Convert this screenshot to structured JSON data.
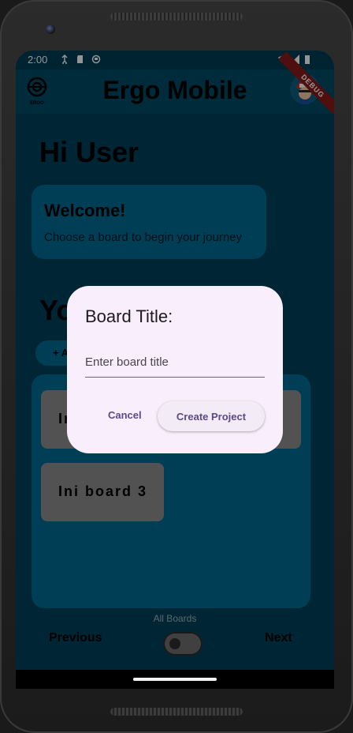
{
  "status_bar": {
    "time": "2:00",
    "icons": [
      "usb-icon",
      "sd-card-icon",
      "sync-icon",
      "wifi-icon",
      "signal-icon",
      "battery-icon"
    ]
  },
  "app_bar": {
    "title": "Ergo Mobile",
    "logo_text": "ERGO",
    "debug_label": "DEBUG"
  },
  "home": {
    "greeting": "Hi  User",
    "welcome": {
      "title": "Welcome!",
      "subtitle": "Choose a board to begin your journey"
    },
    "section_title": "Yo",
    "add_button": "+ A",
    "boards": [
      {
        "label": "Ini"
      },
      {
        "label": "Ini board 3"
      }
    ],
    "all_boards_label": "All Boards",
    "previous": "Previous",
    "next": "Next"
  },
  "dialog": {
    "title": "Board Title:",
    "input_placeholder": "Enter board title",
    "input_value": "",
    "cancel": "Cancel",
    "create": "Create Project"
  },
  "colors": {
    "primary": "#006c95",
    "background": "#00415a",
    "dialog_bg": "#f9eefb",
    "action_text": "#5a4a8a"
  }
}
